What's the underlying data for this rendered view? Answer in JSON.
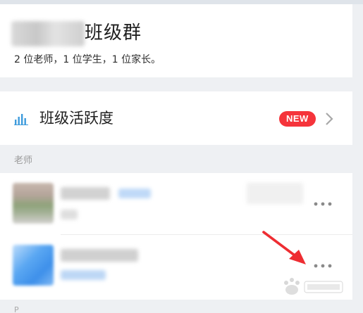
{
  "group": {
    "title": "班级群",
    "subtitle": "2 位老师，1 位学生，1 位家长。"
  },
  "activity": {
    "label": "班级活跃度",
    "badge": "NEW",
    "icon": "bar-chart-icon"
  },
  "section": {
    "teachers_label": "老师",
    "next_label": "P"
  },
  "icons": {
    "more": "more-dots-icon",
    "chevron": "chevron-right-icon",
    "arrow": "red-arrow-icon"
  },
  "colors": {
    "accent_blue": "#3d9bdc",
    "badge_red": "#f5343b",
    "arrow_red": "#ee2d32"
  }
}
